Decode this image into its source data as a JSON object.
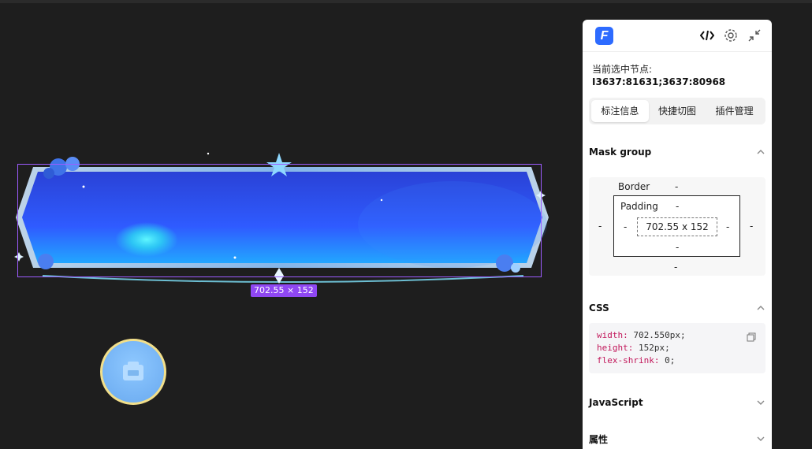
{
  "canvas": {
    "selection_size_badge": "702.55 × 152"
  },
  "panel": {
    "logo_letter": "F",
    "icons": [
      "code-icon",
      "settings-icon",
      "collapse-icon"
    ],
    "node_label": "当前选中节点:",
    "node_value": "I3637:81631;3637:80968",
    "tabs": [
      {
        "label": "标注信息",
        "active": true
      },
      {
        "label": "快捷切图",
        "active": false
      },
      {
        "label": "插件管理",
        "active": false
      }
    ],
    "mask_group": {
      "title": "Mask group",
      "border_label": "Border",
      "border_value": "-",
      "padding_label": "Padding",
      "padding_value": "-",
      "content_size": "702.55 x 152",
      "margin_left": "-",
      "margin_right": "-",
      "margin_bottom": "-",
      "padding_left": "-",
      "padding_right": "-",
      "padding_bottom": "-"
    },
    "css": {
      "title": "CSS",
      "lines": [
        {
          "prop": "width:",
          "value": " 702.550px;"
        },
        {
          "prop": "height:",
          "value": " 152px;"
        },
        {
          "prop": "flex-shrink:",
          "value": " 0;"
        }
      ]
    },
    "javascript_title": "JavaScript",
    "attributes_title": "属性"
  },
  "colors": {
    "accent": "#2d6bff",
    "selection": "#9d5cff",
    "badge": "#8f47f2",
    "frame_blue": "#2f5bff"
  }
}
